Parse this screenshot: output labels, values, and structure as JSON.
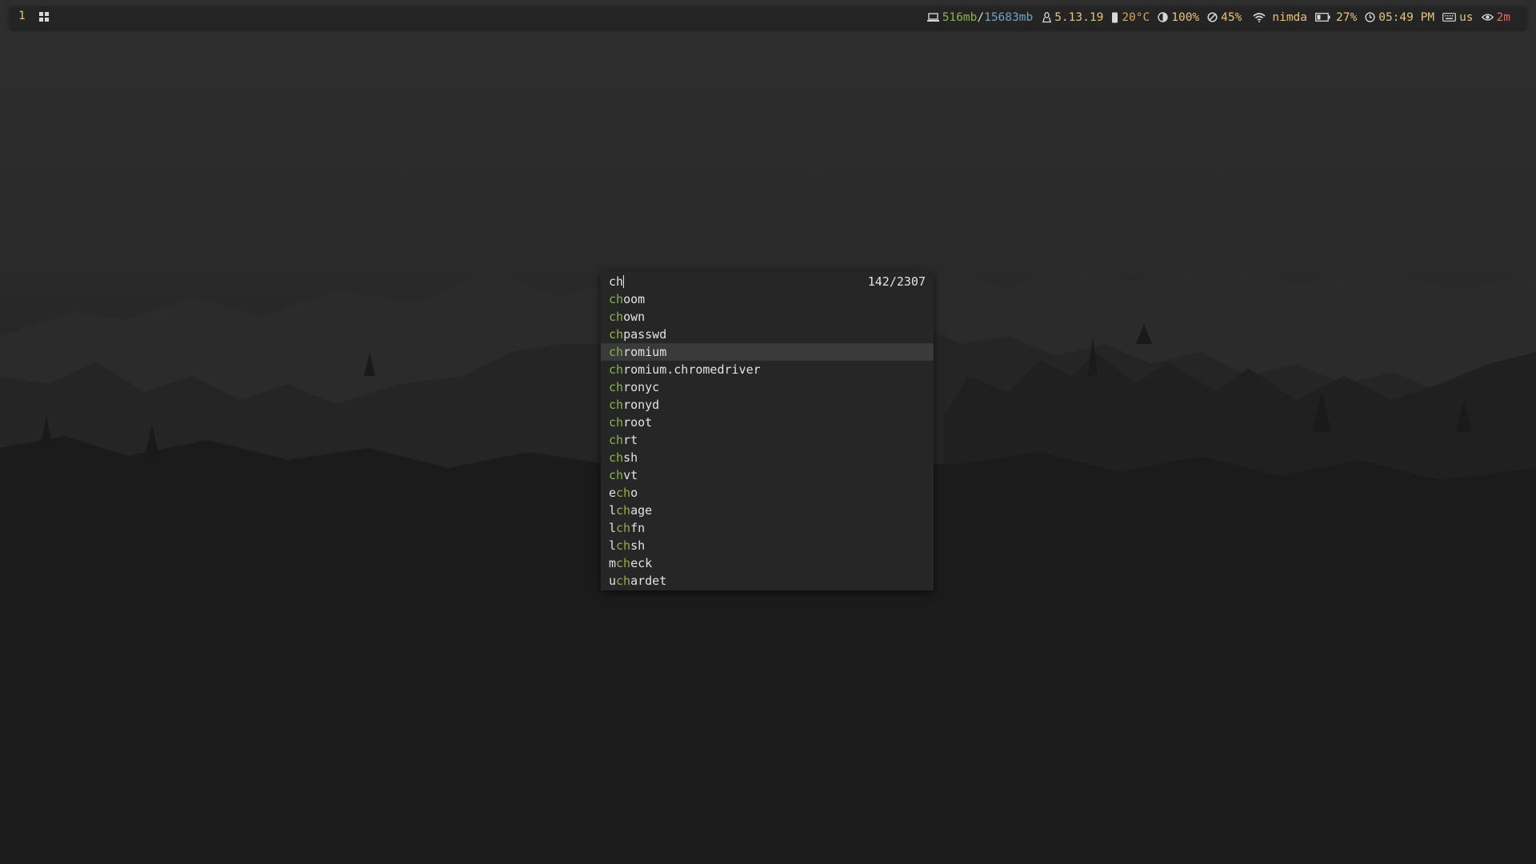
{
  "workspace": {
    "number": "1"
  },
  "status": {
    "memory_used": "516mb",
    "memory_sep": "/",
    "memory_total": "15683mb",
    "kernel": "5.13.19",
    "temperature": "20°C",
    "brightness": "100%",
    "volume": "45%",
    "wifi_name": "nimda",
    "battery": "27%",
    "time": "05:49 PM",
    "keyboard_layout": "us",
    "idle": "2m"
  },
  "colors": {
    "memory_used": "#8fb04f",
    "memory_total": "#6fa3c9",
    "warm": "#e8c27a",
    "temperature": "#e0a050",
    "idle": "#e06c5c"
  },
  "icons": {
    "memory": "laptop-icon",
    "kernel": "tux-icon",
    "temperature": "thermometer-icon",
    "brightness": "contrast-icon",
    "volume": "muted-icon",
    "wifi": "wifi-icon",
    "battery": "battery-icon",
    "time": "clock-icon",
    "keyboard": "keyboard-icon",
    "idle": "eye-icon"
  },
  "launcher": {
    "query": "ch",
    "match_count": "142/2307",
    "selected_index": 3,
    "results": [
      {
        "pre": "",
        "match": "ch",
        "post": "oom"
      },
      {
        "pre": "",
        "match": "ch",
        "post": "own"
      },
      {
        "pre": "",
        "match": "ch",
        "post": "passwd"
      },
      {
        "pre": "",
        "match": "ch",
        "post": "romium"
      },
      {
        "pre": "",
        "match": "ch",
        "post": "romium.chromedriver"
      },
      {
        "pre": "",
        "match": "ch",
        "post": "ronyc"
      },
      {
        "pre": "",
        "match": "ch",
        "post": "ronyd"
      },
      {
        "pre": "",
        "match": "ch",
        "post": "root"
      },
      {
        "pre": "",
        "match": "ch",
        "post": "rt"
      },
      {
        "pre": "",
        "match": "ch",
        "post": "sh"
      },
      {
        "pre": "",
        "match": "ch",
        "post": "vt"
      },
      {
        "pre": "e",
        "match": "ch",
        "post": "o"
      },
      {
        "pre": "l",
        "match": "ch",
        "post": "age"
      },
      {
        "pre": "l",
        "match": "ch",
        "post": "fn"
      },
      {
        "pre": "l",
        "match": "ch",
        "post": "sh"
      },
      {
        "pre": "m",
        "match": "ch",
        "post": "eck"
      },
      {
        "pre": "u",
        "match": "ch",
        "post": "ardet"
      }
    ]
  }
}
